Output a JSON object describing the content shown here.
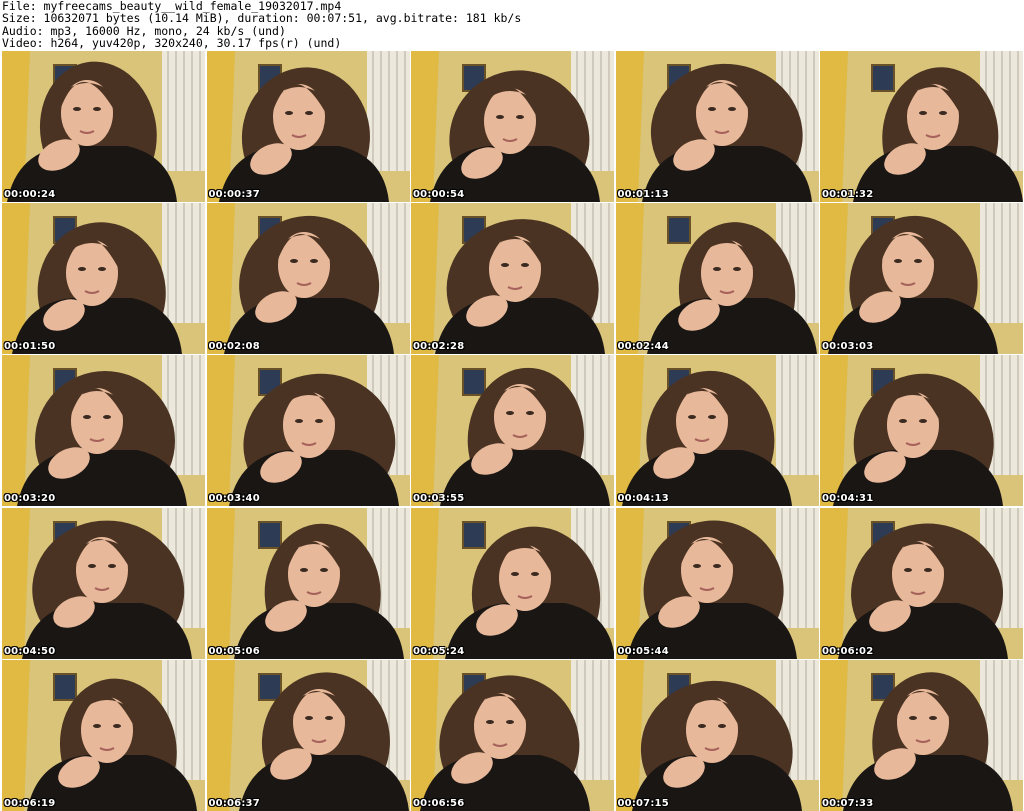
{
  "header": {
    "file_line": "File: myfreecams_beauty__wild_female_19032017.mp4",
    "size_line": "Size: 10632071 bytes (10.14 MiB), duration: 00:07:51, avg.bitrate: 181 kb/s",
    "audio_line": "Audio: mp3, 16000 Hz, mono, 24 kb/s (und)",
    "video_line": "Video: h264, yuv420p, 320x240, 30.17 fps(r) (und)"
  },
  "frames": [
    {
      "timestamp": "00:00:24"
    },
    {
      "timestamp": "00:00:37"
    },
    {
      "timestamp": "00:00:54"
    },
    {
      "timestamp": "00:01:13"
    },
    {
      "timestamp": "00:01:32"
    },
    {
      "timestamp": "00:01:50"
    },
    {
      "timestamp": "00:02:08"
    },
    {
      "timestamp": "00:02:28"
    },
    {
      "timestamp": "00:02:44"
    },
    {
      "timestamp": "00:03:03"
    },
    {
      "timestamp": "00:03:20"
    },
    {
      "timestamp": "00:03:40"
    },
    {
      "timestamp": "00:03:55"
    },
    {
      "timestamp": "00:04:13"
    },
    {
      "timestamp": "00:04:31"
    },
    {
      "timestamp": "00:04:50"
    },
    {
      "timestamp": "00:05:06"
    },
    {
      "timestamp": "00:05:24"
    },
    {
      "timestamp": "00:05:44"
    },
    {
      "timestamp": "00:06:02"
    },
    {
      "timestamp": "00:06:19"
    },
    {
      "timestamp": "00:06:37"
    },
    {
      "timestamp": "00:06:56"
    },
    {
      "timestamp": "00:07:15"
    },
    {
      "timestamp": "00:07:33"
    }
  ],
  "colors": {
    "wall": "#d9c47a",
    "curtain": "#e0b83a",
    "radiator": "#ece8dc",
    "hair": "#4a3322",
    "skin": "#e8b89a",
    "shirt": "#1a1614",
    "timestamp": "#ffffff"
  }
}
